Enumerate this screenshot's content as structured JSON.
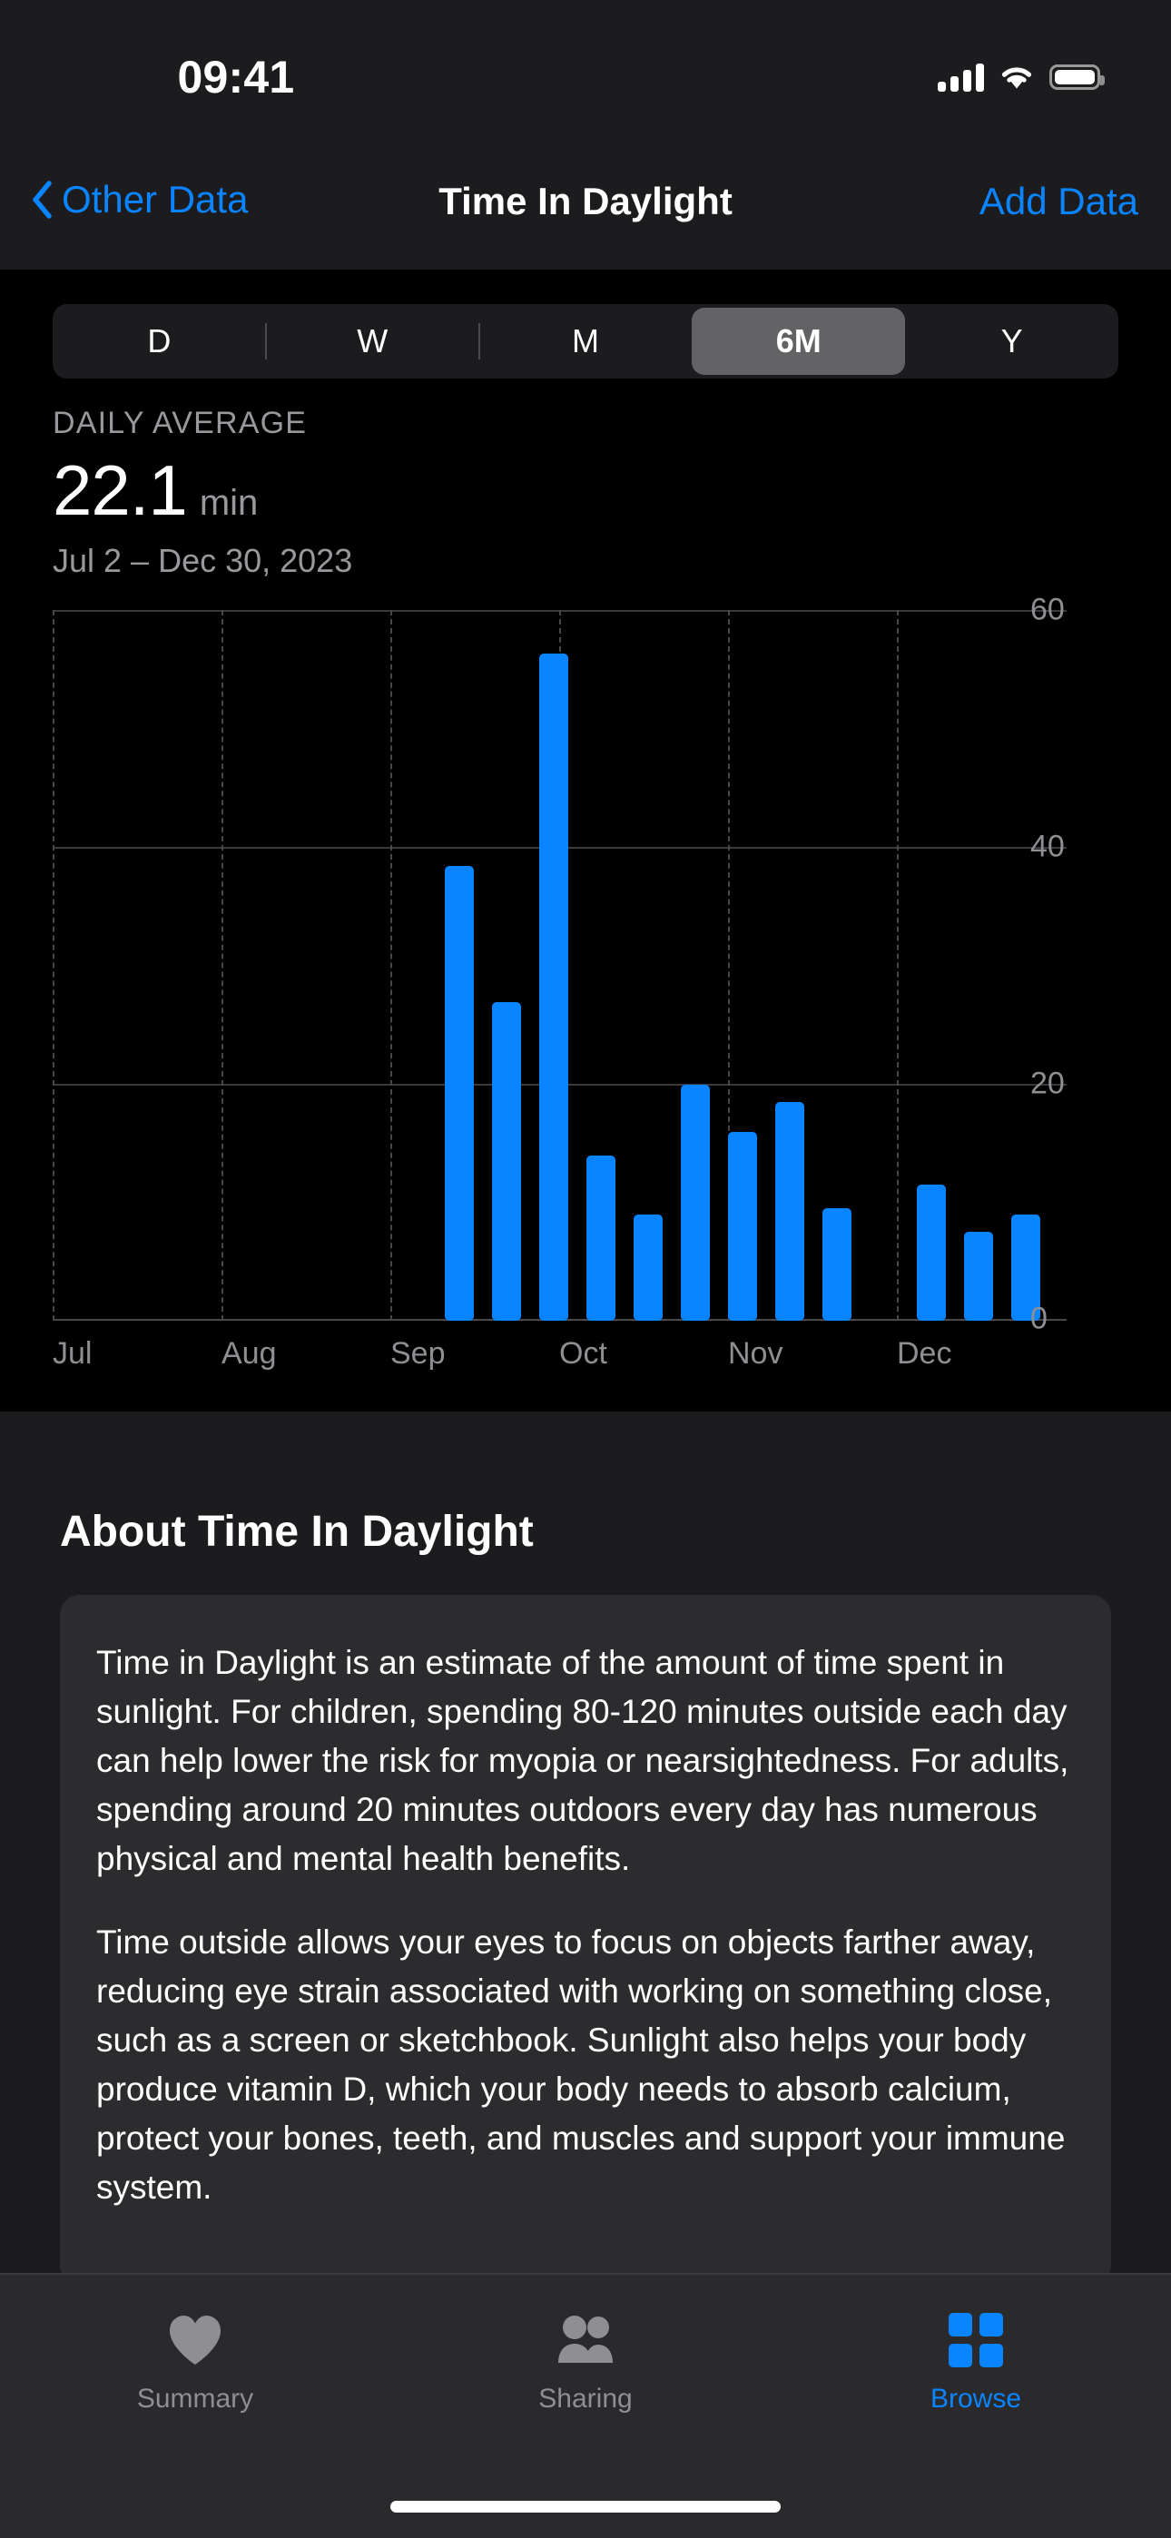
{
  "status_bar": {
    "time": "09:41",
    "signal_icon": "cellular-signal-icon",
    "wifi_icon": "wifi-icon",
    "battery_icon": "battery-full-icon"
  },
  "nav_bar": {
    "back_label": "Other Data",
    "back_icon": "chevron-left-icon",
    "title": "Time In Daylight",
    "action_label": "Add Data"
  },
  "range_selector": {
    "options": [
      "D",
      "W",
      "M",
      "6M",
      "Y"
    ],
    "selected": "6M"
  },
  "summary": {
    "label": "DAILY AVERAGE",
    "value": "22.1",
    "unit": "min",
    "date_range": "Jul 2 – Dec 30, 2023"
  },
  "about": {
    "heading": "About Time In Daylight",
    "paragraph_1": "Time in Daylight is an estimate of the amount of time spent in sunlight. For children, spending 80-120 minutes outside each day can help lower the risk for myopia or nearsightedness. For adults, spending around 20 minutes outdoors every day has numerous physical and mental health benefits.",
    "paragraph_2": "Time outside allows your eyes to focus on objects farther away, reducing eye strain associated with working on something close, such as a screen or sketchbook. Sunlight also helps your body produce vitamin D, which your body needs to absorb calcium, protect your bones, teeth, and muscles and support your immune system."
  },
  "tab_bar": {
    "items": [
      {
        "label": "Summary",
        "icon": "heart-icon",
        "active": false
      },
      {
        "label": "Sharing",
        "icon": "two-people-icon",
        "active": false
      },
      {
        "label": "Browse",
        "icon": "grid-squares-icon",
        "active": true
      }
    ]
  },
  "colors": {
    "accent": "#0a84ff",
    "bar": "#0a84ff",
    "secondary_text": "#98989d",
    "axis_text": "#8e8e93",
    "card": "#1c1c1e",
    "inner_card": "#2c2c2e"
  },
  "chart_data": {
    "type": "bar",
    "title": "Time In Daylight",
    "xlabel": "",
    "ylabel": "min",
    "ylim": [
      0,
      60
    ],
    "yticks": [
      0,
      20,
      40,
      60
    ],
    "xticks": [
      "Jul",
      "Aug",
      "Sep",
      "Oct",
      "Nov",
      "Dec"
    ],
    "grid": true,
    "legend": false,
    "unit": "min",
    "period": "Jul 2 – Dec 30, 2023",
    "daily_average": 22.1,
    "series": [
      {
        "name": "Time in Daylight",
        "color": "#0a84ff",
        "bars": [
          {
            "x": 490,
            "value": 38.5
          },
          {
            "x": 542,
            "value": 27.0
          },
          {
            "x": 594,
            "value": 56.5
          },
          {
            "x": 646,
            "value": 14.0
          },
          {
            "x": 698,
            "value": 9.0
          },
          {
            "x": 750,
            "value": 20.0
          },
          {
            "x": 802,
            "value": 16.0
          },
          {
            "x": 854,
            "value": 18.5
          },
          {
            "x": 906,
            "value": 9.5
          },
          {
            "x": 1010,
            "value": 11.5
          },
          {
            "x": 1062,
            "value": 7.5
          },
          {
            "x": 1114,
            "value": 9.0
          }
        ]
      }
    ]
  }
}
